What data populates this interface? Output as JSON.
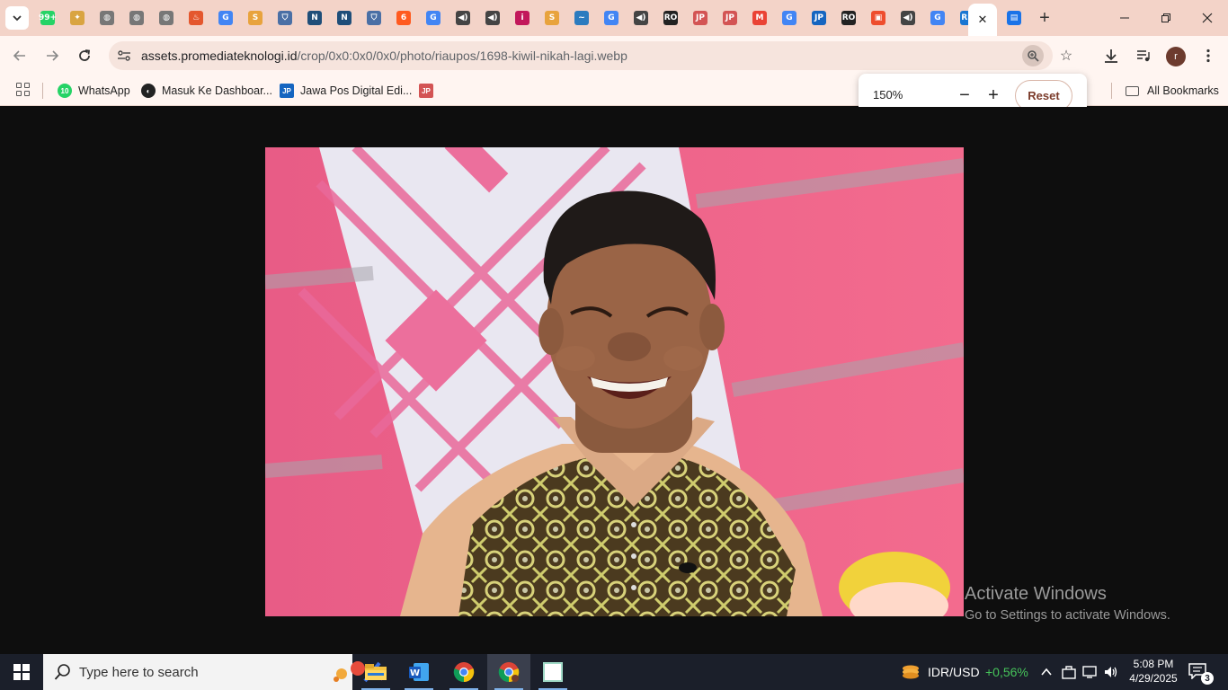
{
  "browser": {
    "tabs": [
      {
        "icon": "whatsapp-icon",
        "color": "#25d366",
        "glyph": "99+"
      },
      {
        "icon": "emblem-icon",
        "color": "#d9a441",
        "glyph": "✦"
      },
      {
        "icon": "globe-icon",
        "color": "#777777",
        "glyph": "◍"
      },
      {
        "icon": "globe-icon",
        "color": "#777777",
        "glyph": "◍"
      },
      {
        "icon": "globe-icon",
        "color": "#777777",
        "glyph": "◍"
      },
      {
        "icon": "flame-icon",
        "color": "#e4572e",
        "glyph": "♨"
      },
      {
        "icon": "google-icon",
        "color": "#4285f4",
        "glyph": "G"
      },
      {
        "icon": "s-icon",
        "color": "#e8a33d",
        "glyph": "S"
      },
      {
        "icon": "shield-icon",
        "color": "#4a6fa5",
        "glyph": "⛉"
      },
      {
        "icon": "news-icon",
        "color": "#1f4e79",
        "glyph": "N"
      },
      {
        "icon": "news-icon",
        "color": "#1f4e79",
        "glyph": "N"
      },
      {
        "icon": "shield-icon",
        "color": "#4a6fa5",
        "glyph": "⛉"
      },
      {
        "icon": "six-icon",
        "color": "#ff5a1f",
        "glyph": "6"
      },
      {
        "icon": "google-icon",
        "color": "#4285f4",
        "glyph": "G"
      },
      {
        "icon": "audio-icon",
        "color": "#444444",
        "glyph": "◀)"
      },
      {
        "icon": "audio-icon",
        "color": "#444444",
        "glyph": "◀)"
      },
      {
        "icon": "ig-icon",
        "color": "#c2185b",
        "glyph": "i"
      },
      {
        "icon": "s-icon",
        "color": "#e8a33d",
        "glyph": "S"
      },
      {
        "icon": "wave-icon",
        "color": "#2b7bbf",
        "glyph": "~"
      },
      {
        "icon": "google-icon",
        "color": "#4285f4",
        "glyph": "G"
      },
      {
        "icon": "audio-icon",
        "color": "#444444",
        "glyph": "◀)"
      },
      {
        "icon": "ro-icon",
        "color": "#222222",
        "glyph": "RO"
      },
      {
        "icon": "jp-icon",
        "color": "#d35454",
        "glyph": "JP"
      },
      {
        "icon": "jp-icon",
        "color": "#d35454",
        "glyph": "JP"
      },
      {
        "icon": "gmail-icon",
        "color": "#ea4335",
        "glyph": "M"
      },
      {
        "icon": "google-icon",
        "color": "#4285f4",
        "glyph": "G"
      },
      {
        "icon": "jp-icon",
        "color": "#1565c0",
        "glyph": "JP"
      },
      {
        "icon": "ro-icon",
        "color": "#222222",
        "glyph": "RO"
      },
      {
        "icon": "shop-icon",
        "color": "#ee4d2d",
        "glyph": "▣"
      },
      {
        "icon": "audio-icon",
        "color": "#444444",
        "glyph": "◀)"
      },
      {
        "icon": "google-icon",
        "color": "#4285f4",
        "glyph": "G"
      },
      {
        "icon": "rp-icon",
        "color": "#1976d2",
        "glyph": "RP"
      }
    ],
    "active_tab_close": "✕",
    "after_tab_icon": {
      "icon": "forms-icon",
      "color": "#1a73e8",
      "glyph": "▤"
    },
    "url_domain": "assets.promediateknologi.id",
    "url_path": "/crop/0x0:0x0/0x0/photo/riaupos/1698-kiwil-nikah-lagi.webp",
    "profile_initial": "r"
  },
  "bookmarks": {
    "items": [
      {
        "label": "WhatsApp",
        "icon": "whatsapp-icon",
        "color": "#25d366",
        "badge": "10"
      },
      {
        "label": "Masuk Ke Dashboar...",
        "icon": "dashboard-icon",
        "color": "#222222",
        "badge": "◐"
      },
      {
        "label": "Jawa Pos Digital Edi...",
        "icon": "jp-icon",
        "color": "#1565c0",
        "badge": "JP"
      },
      {
        "label": "",
        "icon": "jp-icon",
        "color": "#d35454",
        "badge": "JP"
      }
    ],
    "all_label": "All Bookmarks"
  },
  "zoom": {
    "level": "150%",
    "minus": "−",
    "plus": "+",
    "reset_label": "Reset"
  },
  "watermark": {
    "line1": "Activate Windows",
    "line2": "Go to Settings to activate Windows."
  },
  "taskbar": {
    "search_placeholder": "Type here to search",
    "currency_label": "IDR/USD",
    "currency_change": "+0,56%",
    "currency_color": "#46c35a",
    "time": "5:08 PM",
    "date": "4/29/2025",
    "notification_count": "3"
  }
}
